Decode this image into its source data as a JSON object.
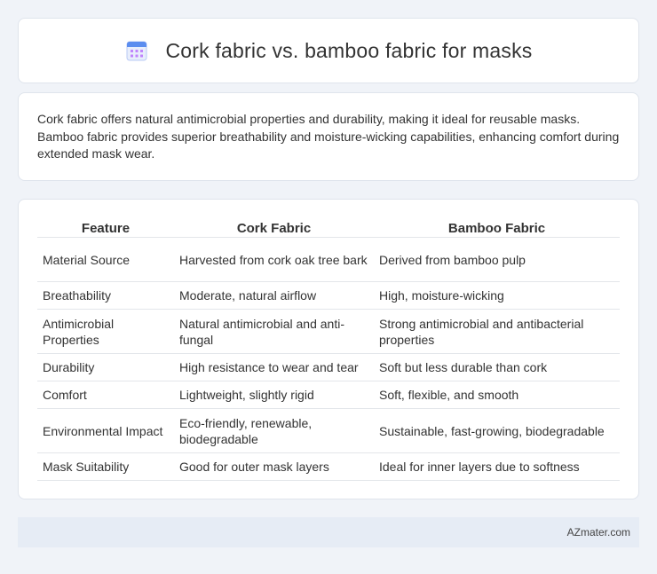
{
  "header": {
    "title": "Cork fabric vs. bamboo fabric for masks",
    "icon": "calendar-icon",
    "icon_colors": {
      "top": "#5b8def",
      "grid": "#c084fc",
      "body": "#e8eefc"
    }
  },
  "intro": {
    "text": "Cork fabric offers natural antimicrobial properties and durability, making it ideal for reusable masks. Bamboo fabric provides superior breathability and moisture-wicking capabilities, enhancing comfort during extended mask wear."
  },
  "table": {
    "headers": [
      "Feature",
      "Cork Fabric",
      "Bamboo Fabric"
    ],
    "rows": [
      [
        "Material Source",
        "Harvested from cork oak tree bark",
        "Derived from bamboo pulp"
      ],
      [
        "Breathability",
        "Moderate, natural airflow",
        "High, moisture-wicking"
      ],
      [
        "Antimicrobial Properties",
        "Natural antimicrobial and anti-fungal",
        "Strong antimicrobial and antibacterial properties"
      ],
      [
        "Durability",
        "High resistance to wear and tear",
        "Soft but less durable than cork"
      ],
      [
        "Comfort",
        "Lightweight, slightly rigid",
        "Soft, flexible, and smooth"
      ],
      [
        "Environmental Impact",
        "Eco-friendly, renewable, biodegradable",
        "Sustainable, fast-growing, biodegradable"
      ],
      [
        "Mask Suitability",
        "Good for outer mask layers",
        "Ideal for inner layers due to softness"
      ]
    ]
  },
  "footer": {
    "brand": "AZmater.com"
  }
}
